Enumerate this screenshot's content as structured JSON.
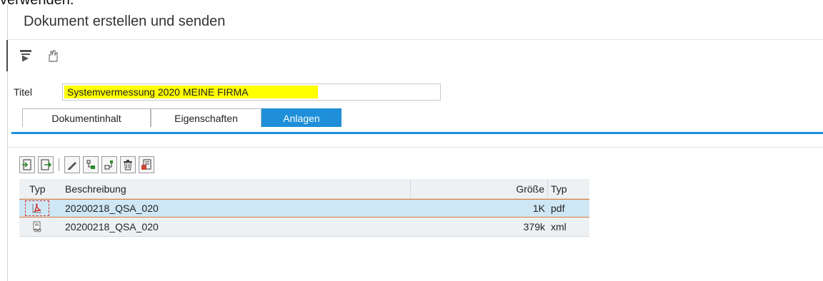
{
  "cropped_top_text": "verwenden.",
  "window": {
    "title": "Dokument erstellen und senden"
  },
  "toolbar": {
    "icons": [
      "send-document-icon",
      "attach-document-icon"
    ]
  },
  "form": {
    "title_label": "Titel",
    "title_value": "Systemvermessung 2020 MEINE FIRMA"
  },
  "tabs": [
    {
      "label": "Dokumentinhalt",
      "active": false
    },
    {
      "label": "Eigenschaften",
      "active": false
    },
    {
      "label": "Anlagen",
      "active": true
    }
  ],
  "attachments_toolbar": {
    "icons": [
      "import-icon",
      "export-icon",
      "edit-icon",
      "move-down-icon",
      "move-up-icon",
      "delete-icon",
      "display-icon"
    ]
  },
  "grid": {
    "headers": {
      "typ": "Typ",
      "beschreibung": "Beschreibung",
      "groesse": "Größe",
      "typ2": "Typ"
    },
    "rows": [
      {
        "icon": "pdf-icon",
        "beschreibung": "20200218_QSA_020",
        "groesse": "1K",
        "typ": "pdf",
        "selected": true
      },
      {
        "icon": "xml-document-icon",
        "beschreibung": "20200218_QSA_020",
        "groesse": "379k",
        "typ": "xml",
        "selected": false
      }
    ]
  },
  "colors": {
    "accent": "#1e8fd8",
    "highlight": "#ffff00",
    "selected_row": "#cfe7f5",
    "selection_border": "#e07a33"
  }
}
